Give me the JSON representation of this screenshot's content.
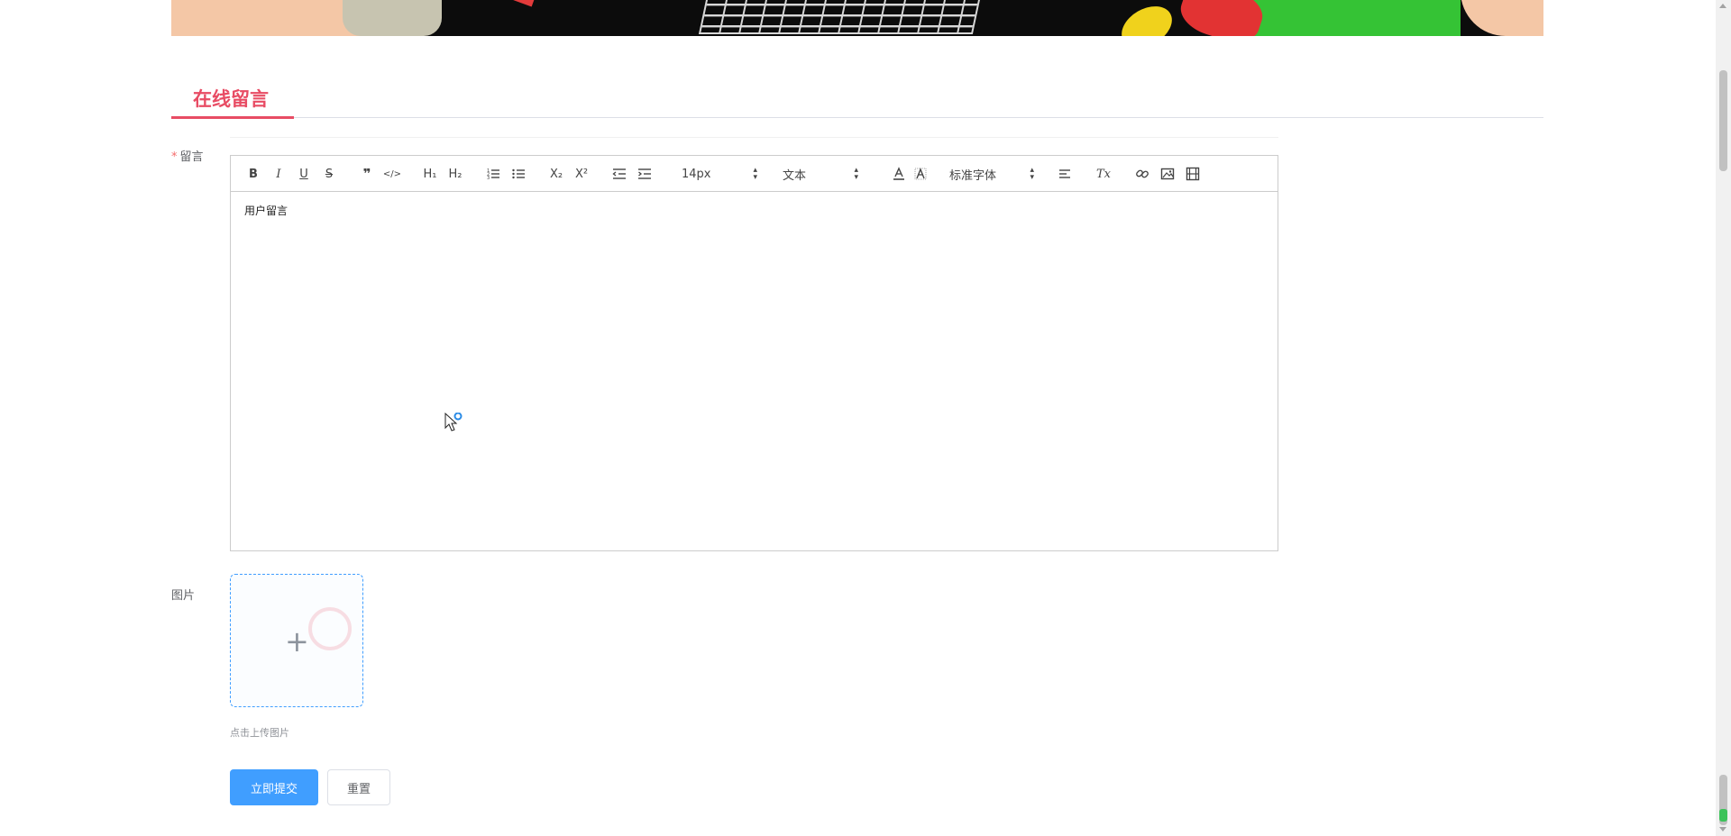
{
  "section": {
    "title": "在线留言"
  },
  "form": {
    "message_label": "留言",
    "required_mark": "*",
    "image_label": "图片",
    "upload_tip": "点击上传图片",
    "submit_label": "立即提交",
    "reset_label": "重置"
  },
  "editor": {
    "content": "用户留言",
    "toolbar": {
      "bold": "B",
      "italic": "I",
      "underline": "U",
      "strike": "S",
      "blockquote": "❞",
      "code": "</>",
      "h1": "H₁",
      "h2": "H₂",
      "subscript": "X₂",
      "superscript": "X²",
      "size_picker": "14px",
      "header_picker": "文本",
      "font_picker": "标准字体",
      "clean": "Tx"
    }
  },
  "colors": {
    "accent": "#e84c64",
    "primary": "#409eff"
  }
}
